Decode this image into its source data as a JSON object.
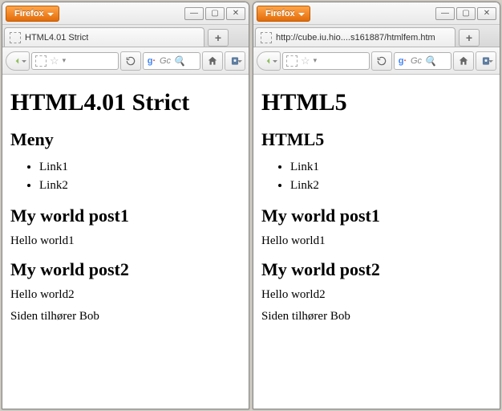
{
  "app": {
    "menu_label": "Firefox"
  },
  "window_controls": {
    "min": "—",
    "max": "▢",
    "close": "✕"
  },
  "toolbar": {
    "search_placeholder": "Gc",
    "newtab_label": "+"
  },
  "windows": [
    {
      "tab_title": "HTML4.01 Strict",
      "page": {
        "h1": "HTML4.01 Strict",
        "nav_heading": "Meny",
        "links": [
          "Link1",
          "Link2"
        ],
        "posts": [
          {
            "title": "My world post1",
            "body": "Hello world1"
          },
          {
            "title": "My world post2",
            "body": "Hello world2"
          }
        ],
        "footer": "Siden tilhører Bob"
      }
    },
    {
      "tab_title": "http://cube.iu.hio....s161887/htmlfem.htm",
      "page": {
        "h1": "HTML5",
        "nav_heading": "HTML5",
        "links": [
          "Link1",
          "Link2"
        ],
        "posts": [
          {
            "title": "My world post1",
            "body": "Hello world1"
          },
          {
            "title": "My world post2",
            "body": "Hello world2"
          }
        ],
        "footer": "Siden tilhører Bob"
      }
    }
  ]
}
